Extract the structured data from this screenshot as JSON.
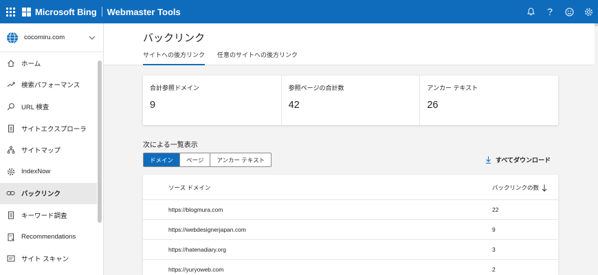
{
  "header": {
    "brand": "Microsoft Bing",
    "product": "Webmaster Tools",
    "icons": [
      "bell-icon",
      "help-icon",
      "smiley-icon",
      "gear-icon"
    ]
  },
  "sidebar": {
    "site": "cocomiru.com",
    "items": [
      {
        "label": "ホーム",
        "icon": "home-icon"
      },
      {
        "label": "検索パフォーマンス",
        "icon": "trend-icon"
      },
      {
        "label": "URL 検査",
        "icon": "search-icon"
      },
      {
        "label": "サイトエクスプローラ",
        "icon": "document-icon"
      },
      {
        "label": "サイトマップ",
        "icon": "sitemap-icon"
      },
      {
        "label": "IndexNow",
        "icon": "gear-icon"
      },
      {
        "label": "バックリンク",
        "icon": "link-icon",
        "active": true
      },
      {
        "label": "キーワード調査",
        "icon": "document-icon"
      },
      {
        "label": "Recommendations",
        "icon": "recommend-icon"
      },
      {
        "label": "サイト スキャン",
        "icon": "scan-icon"
      }
    ]
  },
  "page": {
    "title": "バックリンク",
    "tabs": [
      "サイトへの後方リンク",
      "任意のサイトへの後方リンク"
    ],
    "active_tab": "サイトへの後方リンク"
  },
  "summary": [
    {
      "label": "合計参照ドメイン",
      "value": "9"
    },
    {
      "label": "参照ページの合計数",
      "value": "42"
    },
    {
      "label": "アンカー テキスト",
      "value": "26"
    }
  ],
  "list": {
    "heading": "次による一覧表示",
    "segments": [
      "ドメイン",
      "ページ",
      "アンカー テキスト"
    ],
    "active_segment": "ドメイン",
    "download_label": "すべてダウンロード"
  },
  "table": {
    "headers": [
      "ソース ドメイン",
      "バックリンクの数"
    ],
    "rows": [
      {
        "source": "https://blogmura.com",
        "count": "22"
      },
      {
        "source": "https://webdesignerjapan.com",
        "count": "9"
      },
      {
        "source": "https://hatenadiary.org",
        "count": "3"
      },
      {
        "source": "https://yuryoweb.com",
        "count": "2"
      }
    ]
  },
  "colors": {
    "accent": "#0f6cbd",
    "active_nav_bg": "#e8e8e8"
  }
}
